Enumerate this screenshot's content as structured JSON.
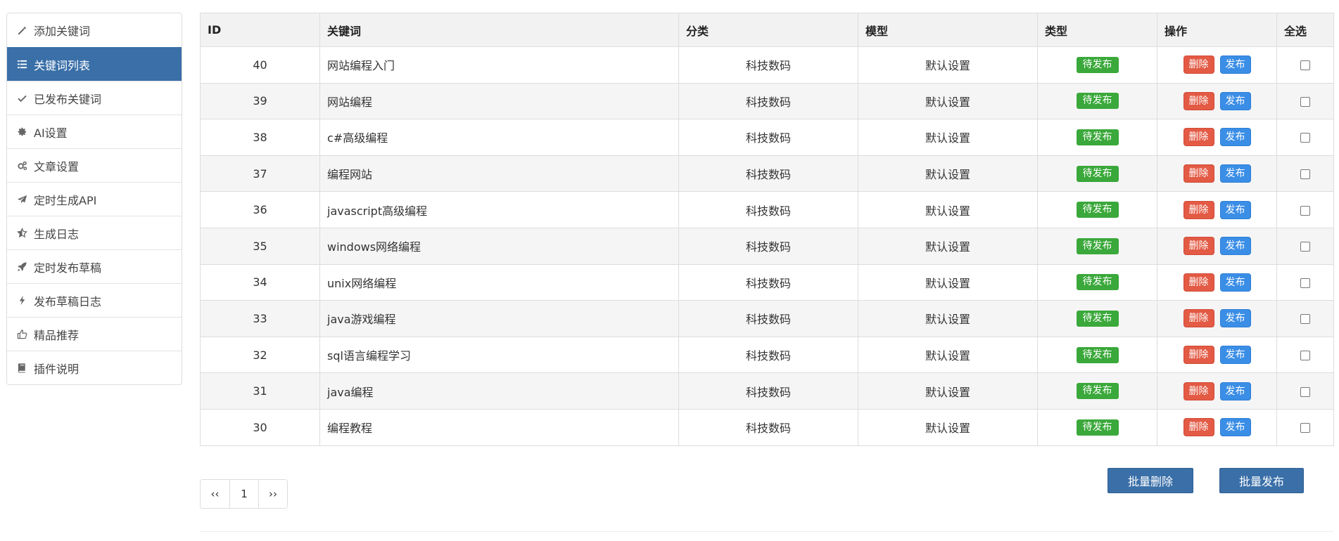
{
  "sidebar": {
    "items": [
      {
        "label": "添加关键词",
        "icon": "pencil-icon",
        "active": false
      },
      {
        "label": "关键词列表",
        "icon": "list-icon",
        "active": true
      },
      {
        "label": "已发布关键词",
        "icon": "check-icon",
        "active": false
      },
      {
        "label": "AI设置",
        "icon": "gear-icon",
        "active": false
      },
      {
        "label": "文章设置",
        "icon": "gears-icon",
        "active": false
      },
      {
        "label": "定时生成API",
        "icon": "plane-icon",
        "active": false
      },
      {
        "label": "生成日志",
        "icon": "star-half-icon",
        "active": false
      },
      {
        "label": "定时发布草稿",
        "icon": "rocket-icon",
        "active": false
      },
      {
        "label": "发布草稿日志",
        "icon": "bolt-icon",
        "active": false
      },
      {
        "label": "精品推荐",
        "icon": "thumbs-up-icon",
        "active": false
      },
      {
        "label": "插件说明",
        "icon": "book-icon",
        "active": false
      }
    ]
  },
  "table": {
    "headers": {
      "id": "ID",
      "keyword": "关键词",
      "category": "分类",
      "model": "模型",
      "type": "类型",
      "ops": "操作",
      "select": "全选"
    },
    "delete_label": "删除",
    "publish_label": "发布",
    "rows": [
      {
        "id": "40",
        "keyword": "网站编程入门",
        "category": "科技数码",
        "model": "默认设置",
        "status": "待发布"
      },
      {
        "id": "39",
        "keyword": "网站编程",
        "category": "科技数码",
        "model": "默认设置",
        "status": "待发布"
      },
      {
        "id": "38",
        "keyword": "c#高级编程",
        "category": "科技数码",
        "model": "默认设置",
        "status": "待发布"
      },
      {
        "id": "37",
        "keyword": "编程网站",
        "category": "科技数码",
        "model": "默认设置",
        "status": "待发布"
      },
      {
        "id": "36",
        "keyword": "javascript高级编程",
        "category": "科技数码",
        "model": "默认设置",
        "status": "待发布"
      },
      {
        "id": "35",
        "keyword": "windows网络编程",
        "category": "科技数码",
        "model": "默认设置",
        "status": "待发布"
      },
      {
        "id": "34",
        "keyword": "unix网络编程",
        "category": "科技数码",
        "model": "默认设置",
        "status": "待发布"
      },
      {
        "id": "33",
        "keyword": "java游戏编程",
        "category": "科技数码",
        "model": "默认设置",
        "status": "待发布"
      },
      {
        "id": "32",
        "keyword": "sql语言编程学习",
        "category": "科技数码",
        "model": "默认设置",
        "status": "待发布"
      },
      {
        "id": "31",
        "keyword": "java编程",
        "category": "科技数码",
        "model": "默认设置",
        "status": "待发布"
      },
      {
        "id": "30",
        "keyword": "编程教程",
        "category": "科技数码",
        "model": "默认设置",
        "status": "待发布"
      }
    ]
  },
  "pager": {
    "prev": "‹‹",
    "page": "1",
    "next": "››"
  },
  "bulk": {
    "delete_label": "批量删除",
    "publish_label": "批量发布"
  },
  "colors": {
    "active_sidebar": "#3a6fa8",
    "pending_badge": "#3aa83a",
    "delete_button": "#e35a45",
    "publish_button": "#3b8ee6"
  }
}
